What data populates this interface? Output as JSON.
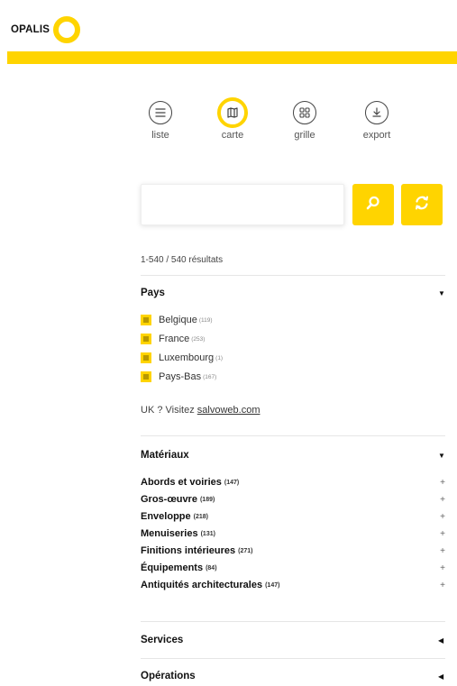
{
  "brand": {
    "name": "OPALIS",
    "accent": "#ffd400"
  },
  "views": [
    {
      "label": "liste",
      "icon": "list-icon",
      "active": false
    },
    {
      "label": "carte",
      "icon": "map-icon",
      "active": true
    },
    {
      "label": "grille",
      "icon": "grid-icon",
      "active": false
    },
    {
      "label": "export",
      "icon": "download-icon",
      "active": false
    }
  ],
  "search": {
    "value": "",
    "placeholder": "",
    "search_icon": "search-icon",
    "reset_icon": "refresh-icon"
  },
  "results": "1-540 / 540 résultats",
  "pays": {
    "title": "Pays",
    "items": [
      {
        "label": "Belgique",
        "count": "(119)"
      },
      {
        "label": "France",
        "count": "(253)"
      },
      {
        "label": "Luxembourg",
        "count": "(1)"
      },
      {
        "label": "Pays-Bas",
        "count": "(167)"
      }
    ],
    "uk_text": "UK ? Visitez ",
    "uk_link": "salvoweb.com"
  },
  "materiaux": {
    "title": "Matériaux",
    "items": [
      {
        "label": "Abords et voiries",
        "count": "(147)"
      },
      {
        "label": "Gros-œuvre",
        "count": "(189)"
      },
      {
        "label": "Enveloppe",
        "count": "(218)"
      },
      {
        "label": "Menuiseries",
        "count": "(131)"
      },
      {
        "label": "Finitions intérieures",
        "count": "(271)"
      },
      {
        "label": "Équipements",
        "count": "(84)"
      },
      {
        "label": "Antiquités architecturales",
        "count": "(147)"
      }
    ]
  },
  "services": {
    "title": "Services"
  },
  "operations": {
    "title": "Opérations"
  }
}
